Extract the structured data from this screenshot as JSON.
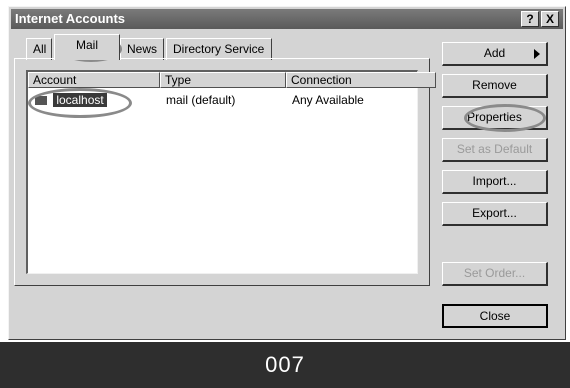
{
  "window": {
    "title": "Internet Accounts",
    "help_label": "?",
    "close_label": "X"
  },
  "tabs": [
    {
      "label": "All"
    },
    {
      "label": "Mail"
    },
    {
      "label": "News"
    },
    {
      "label": "Directory Service"
    }
  ],
  "list": {
    "columns": [
      "Account",
      "Type",
      "Connection"
    ],
    "rows": [
      {
        "account": "localhost",
        "type": "mail (default)",
        "connection": "Any Available"
      }
    ]
  },
  "buttons": {
    "add": "Add",
    "remove": "Remove",
    "properties": "Properties",
    "set_default": "Set as Default",
    "import": "Import...",
    "export": "Export...",
    "set_order": "Set Order...",
    "close": "Close"
  },
  "caption": "007",
  "colors": {
    "dialog_bg": "#d4d4d4",
    "titlebar": "#6a6a6a",
    "selection": "#3a3a3a",
    "caption_bar": "#2e2e2e"
  }
}
